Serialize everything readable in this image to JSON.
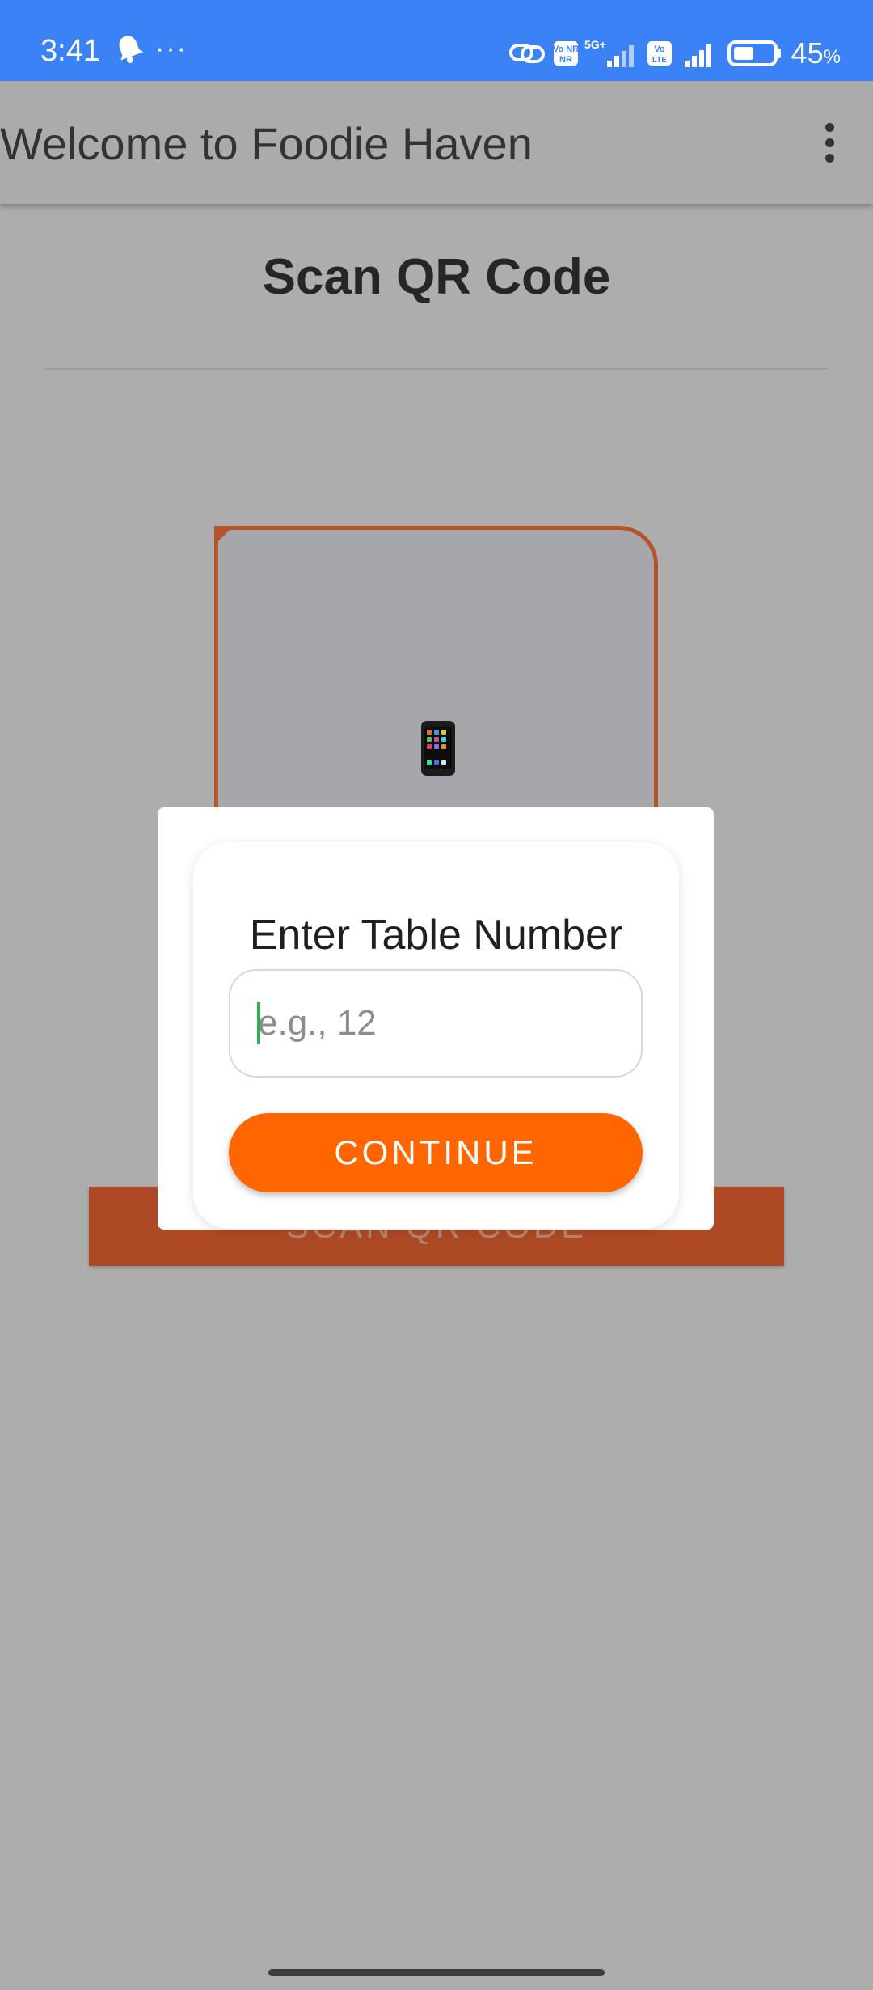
{
  "status_bar": {
    "time": "3:41",
    "more_indicator": "···",
    "battery_level": "45",
    "battery_unit": "%",
    "network_labels": [
      "Vo NR",
      "5G+",
      "Vo LTE"
    ],
    "icons": [
      "notification-bell-icon",
      "link-icon",
      "signal-icon",
      "battery-icon"
    ]
  },
  "app_bar": {
    "title": "Welcome to Foodie Haven",
    "menu_icon": "more-vert-icon"
  },
  "page": {
    "title": "Scan QR Code",
    "scan_icon": "mobile-phone-icon",
    "scan_button_label": "SCAN QR CODE"
  },
  "dialog": {
    "title": "Enter Table Number",
    "input_placeholder": "e.g., 12",
    "input_value": "",
    "continue_label": "CONTINUE"
  },
  "colors": {
    "status_bar": "#3b82f6",
    "accent": "#ff6600",
    "scan_frame": "#b5532a",
    "overlay": "#adadad"
  }
}
